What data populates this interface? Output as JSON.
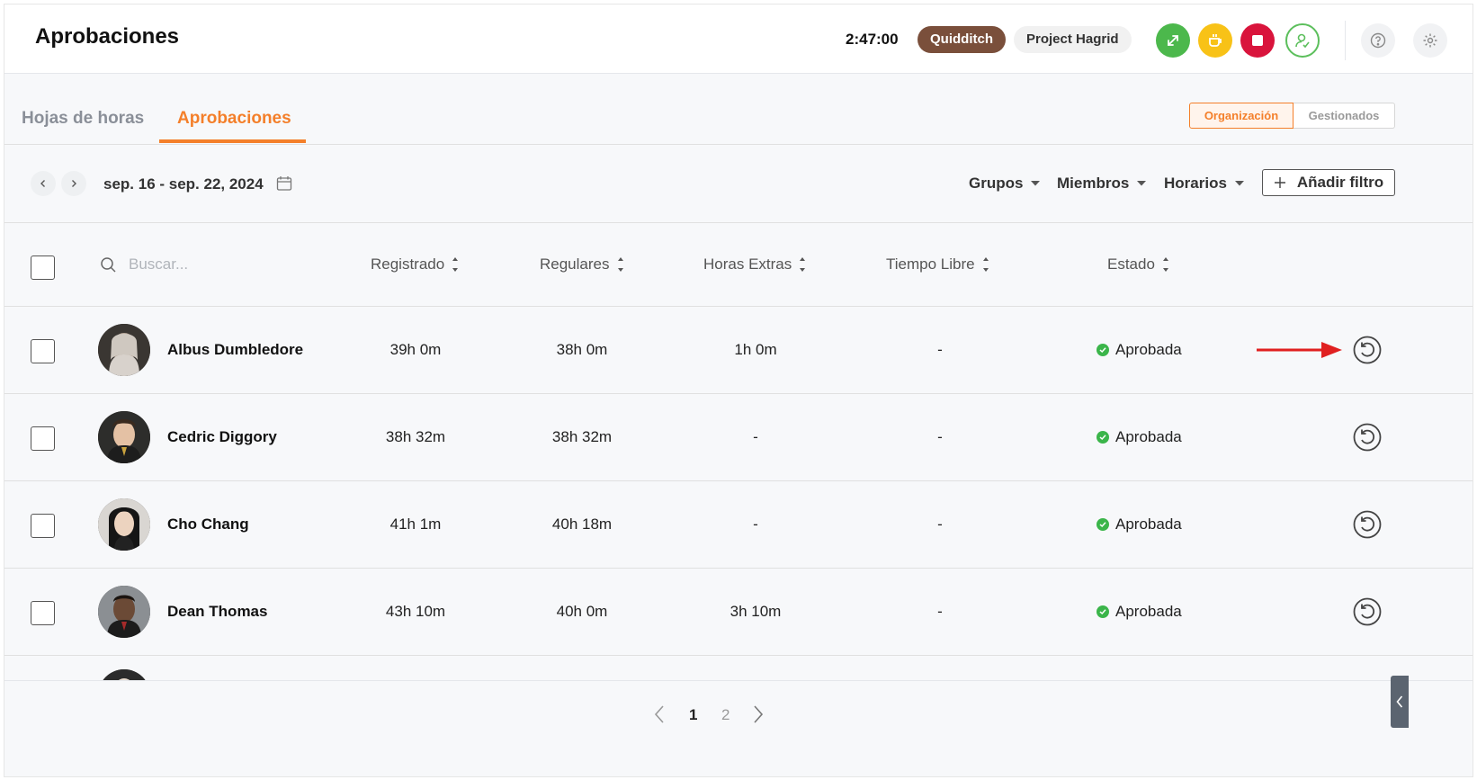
{
  "header": {
    "title": "Aprobaciones",
    "timer": "2:47:00",
    "project": "Quidditch",
    "client": "Project Hagrid",
    "colors": {
      "accent": "#f47f2a",
      "project_pill": "#7a4f3b",
      "switch": "#4cb84c",
      "break": "#f8c217",
      "stop": "#d9143c"
    }
  },
  "tabs": [
    {
      "label": "Hojas de horas",
      "active": false
    },
    {
      "label": "Aprobaciones",
      "active": true
    }
  ],
  "scope": {
    "organization": "Organización",
    "managed": "Gestionados"
  },
  "filters": {
    "date_range": "sep. 16 - sep. 22, 2024",
    "groups": "Grupos",
    "members": "Miembros",
    "schedules": "Horarios",
    "add_filter": "Añadir filtro"
  },
  "table": {
    "search_placeholder": "Buscar...",
    "columns": [
      "Registrado",
      "Regulares",
      "Horas Extras",
      "Tiempo Libre",
      "Estado"
    ],
    "rows": [
      {
        "name": "Albus Dumbledore",
        "registered": "39h 0m",
        "regular": "38h 0m",
        "overtime": "1h 0m",
        "time_off": "-",
        "status": "Aprobada"
      },
      {
        "name": "Cedric Diggory",
        "registered": "38h 32m",
        "regular": "38h 32m",
        "overtime": "-",
        "time_off": "-",
        "status": "Aprobada"
      },
      {
        "name": "Cho Chang",
        "registered": "41h 1m",
        "regular": "40h 18m",
        "overtime": "-",
        "time_off": "-",
        "status": "Aprobada"
      },
      {
        "name": "Dean Thomas",
        "registered": "43h 10m",
        "regular": "40h 0m",
        "overtime": "3h 10m",
        "time_off": "-",
        "status": "Aprobada"
      }
    ]
  },
  "pagination": {
    "pages": [
      "1",
      "2"
    ],
    "current": "1"
  }
}
